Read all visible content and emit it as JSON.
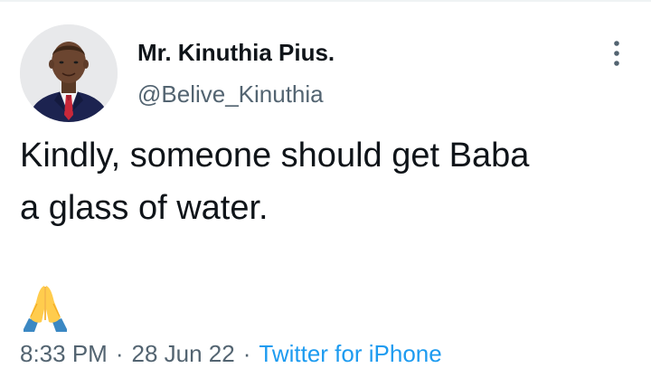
{
  "author": {
    "display_name": "Mr. Kinuthia Pius.",
    "handle": "@Belive_Kinuthia",
    "avatar_icon": "profile-photo"
  },
  "tweet": {
    "text_lines": [
      "Kindly, someone should get Baba",
      "a glass of water."
    ],
    "emoji": "folded-hands-emoji"
  },
  "meta": {
    "time": "8:33 PM",
    "separator": "·",
    "date": "28 Jun 22",
    "source": "Twitter for iPhone"
  },
  "icons": {
    "more": "more-options-icon"
  },
  "colors": {
    "text": "#0f1419",
    "secondary": "#536471",
    "link": "#1d9bf0",
    "background": "#ffffff"
  }
}
